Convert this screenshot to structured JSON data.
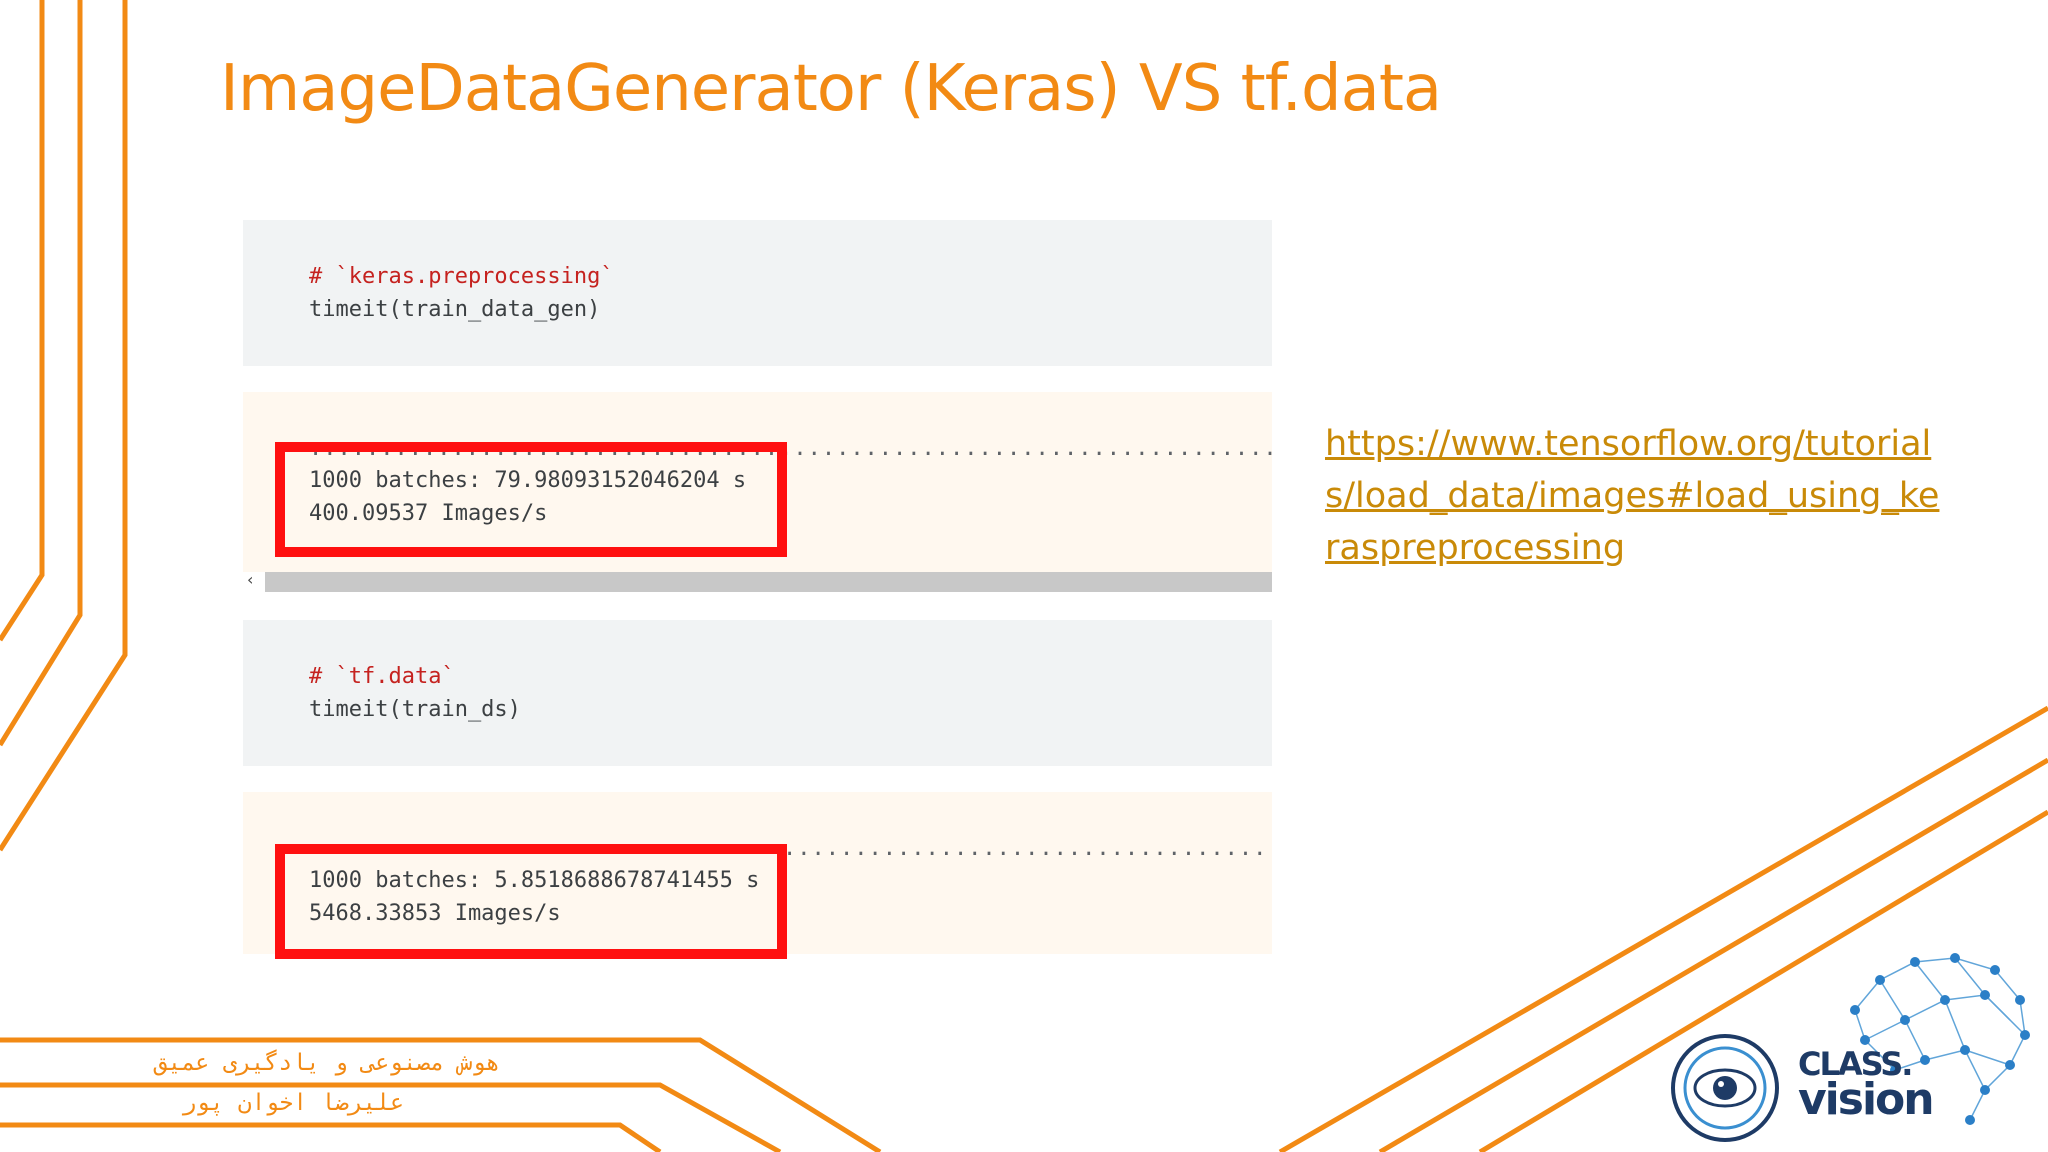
{
  "slide": {
    "title": "ImageDataGenerator (Keras) VS tf.data",
    "link": "https://www.tensorflow.org/tutorials/load_data/images#load_using_keraspreprocessing",
    "footer_line_1": "هوش مصنوعی و یادگیری عمیق",
    "footer_line_2": "علیرضا اخوان پور",
    "accent_color": "#f28a14",
    "highlight_color": "#ff1010"
  },
  "cells": [
    {
      "input_comment": "# `keras.preprocessing`",
      "input_code": "timeit(train_data_gen)",
      "output_line_1": "1000 batches: 79.98093152046204 s",
      "output_line_2": "400.09537 Images/s"
    },
    {
      "input_comment": "# `tf.data`",
      "input_code": "timeit(train_ds)",
      "output_line_1": "1000 batches: 5.8518688678741455 s",
      "output_line_2": "5468.33853 Images/s"
    }
  ],
  "scrollbar": {
    "arrow_icon": "chevron-left-icon"
  },
  "logo": {
    "brand_line_1": "CLASS.",
    "brand_line_2": "vision",
    "icon": "neural-brain-icon"
  }
}
